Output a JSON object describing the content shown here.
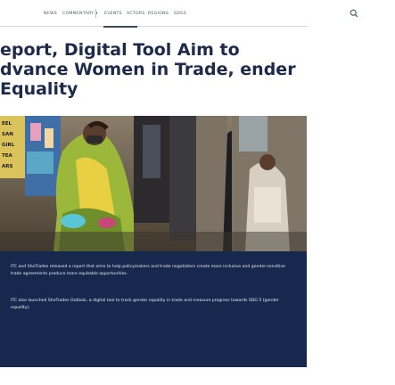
{
  "nav": {
    "items": [
      {
        "label": "NEWS"
      },
      {
        "label": "COMMENTARY ▾"
      },
      {
        "label": "EVENTS"
      },
      {
        "label": "ACTORS"
      },
      {
        "label": "REGIONS"
      },
      {
        "label": "SDGS"
      }
    ]
  },
  "article": {
    "title": "eport, Digital Tool Aim to dvance Women in Trade, ender Equality"
  },
  "photo": {
    "sign_lines": [
      "EEL",
      "SAN",
      "GIRL",
      "TEA",
      "ARS"
    ]
  },
  "caption": {
    "paragraph1": "ITC and SheTrades released a report that aims to help policymakers and trade negotiators create more inclusive and gender-sensitive trade agreements produce more equitable opportunities.",
    "paragraph2": "ITC also launched SheTrades Outlook, a digital tool to track gender equality in trade and measure progress towards SDG 5 (gender equality)."
  },
  "colors": {
    "headline": "#1d2a4a",
    "caption_bg": "#16284e",
    "caption_text": "#e8edf5",
    "nav_text": "#4a5566"
  }
}
